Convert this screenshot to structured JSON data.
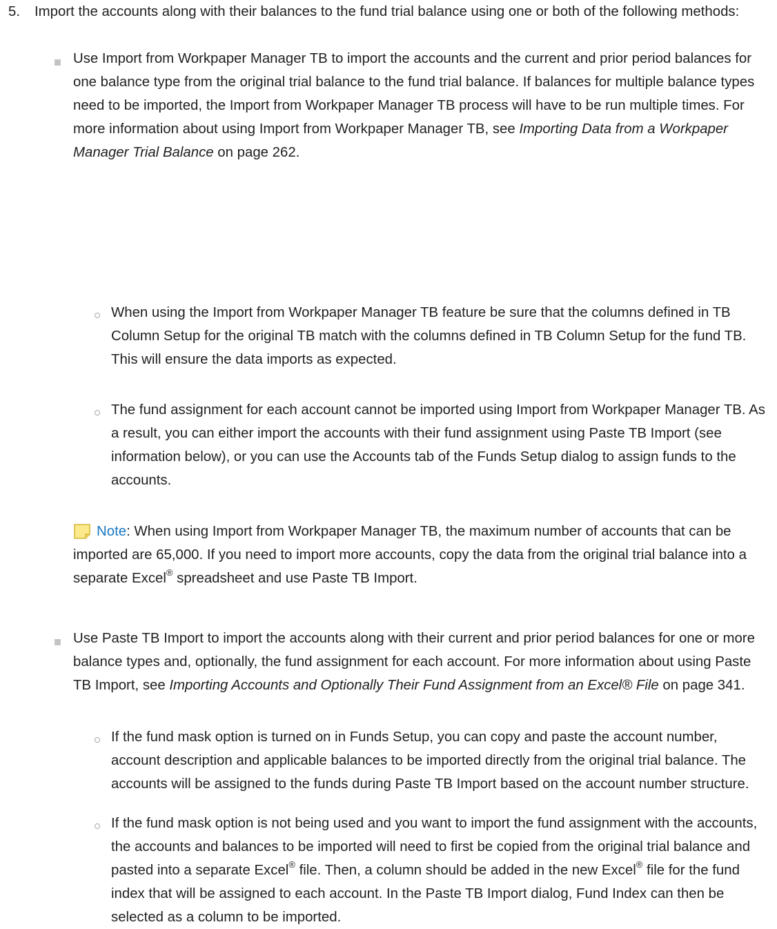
{
  "step": {
    "number": "5.",
    "text": "Import the accounts along with their balances to the fund trial balance using one or both of the following methods:"
  },
  "bullet1": {
    "text_before_link": "Use Import from Workpaper Manager TB to import the accounts and the current and prior period balances for one balance type from the original trial balance to the fund trial balance. If balances for multiple balance types need to be imported, the Import from Workpaper Manager TB process will have to be run multiple times. For more information about using Import from Workpaper Manager TB, see ",
    "link_text": "Importing Data from a Workpaper Manager Trial Balance",
    "page_ref": " on page 262.",
    "sub1": "When using the Import from Workpaper Manager TB feature be sure that the columns defined in TB Column Setup for the original TB match with the columns defined in TB Column Setup for the fund TB. This will ensure the data imports as expected.",
    "sub2": "The fund assignment for each account cannot be imported using Import from Workpaper Manager TB. As a result, you can either import the accounts with their fund assignment using Paste TB Import (see information below), or you can use the Accounts tab of the Funds Setup dialog to assign funds to the accounts."
  },
  "note": {
    "label": "Note",
    "text_1": ": When using Import from Workpaper Manager TB, the maximum number of accounts that can be imported are 65,000. If you need to import more accounts, copy the data from the original trial balance into a separate Excel",
    "registered": "®",
    "text_2": " spreadsheet and use Paste TB Import."
  },
  "bullet2": {
    "text_before_link": "Use Paste TB Import to import the accounts along with their current and prior period balances for one or more balance types and, optionally, the fund assignment for each account. For more information about using Paste TB Import, see ",
    "link_text": "Importing Accounts and Optionally Their Fund Assignment from an Excel® File",
    "page_ref": " on page 341.",
    "sub1": "If the fund mask option is turned on in Funds Setup, you can copy and paste the account number, account description and applicable balances to be imported directly from the original trial balance. The accounts will be assigned to the funds during Paste TB Import based on the account number structure.",
    "sub2_part1": "If the fund mask option is not being used and you want to import the fund assignment with the accounts, the accounts and balances to be imported will need to first be copied from the original trial balance and pasted into a separate Excel",
    "sub2_reg1": "®",
    "sub2_part2": " file. Then, a column should be added in the new Excel",
    "sub2_reg2": "®",
    "sub2_part3": " file for the fund index that will be assigned to each account. In the Paste TB Import dialog, Fund Index can then be selected as a column to be imported."
  },
  "colors": {
    "note_label": "#1a78c2",
    "note_icon_fill": "#fbe98c",
    "note_icon_border": "#d6b838",
    "bullet_square": "#c4c4c4",
    "bullet_circle": "#a8a8a8"
  }
}
